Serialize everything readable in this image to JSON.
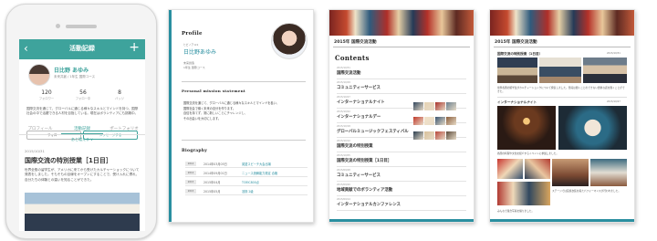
{
  "phone": {
    "app_title": "活動記録",
    "back_glyph": "‹",
    "plus_glyph": "+",
    "name": "日比野 あゆみ",
    "subtitle": "未来共創 / 1年生 国際コース",
    "stats": [
      {
        "value": "120",
        "label": "フォロワー"
      },
      {
        "value": "56",
        "label": "フォロー中"
      },
      {
        "value": "8",
        "label": "バッジ"
      }
    ],
    "description": "国際交流を通じて、グローバルに通じる様々なスキルとマインドを持つ、国際社会の中で活躍できる人材を目指している。現在はボランティアにも挑戦中。",
    "btn_follow": "フォロー",
    "btn_message": "メッセージする",
    "tabs": [
      "プロフィール",
      "活動記録",
      "ポートフォリオ"
    ],
    "more": "あと増える ∨",
    "article_date": "2015/10/31",
    "article_title": "国際交流の特別授業［1日目］",
    "article_body": "世界全般の留学生が、アメリカに来てから受けたカルチャーショックについて発表をしました。そもそもの目線をオープンにすることで、受け入れに慣れ、自分たちの体験との違いを知ることができた。"
  },
  "page1": {
    "section_profile": "Profile",
    "name_small": "ヒビノアユミ",
    "name": "日比野あゆみ",
    "meta1": "未来創造",
    "meta2": "1年生 国際コース",
    "section_mission": "Personal mission statement",
    "mission_lines": [
      "国際交流を通じて、グローバルに通じる様々なスキルとマインドを養い、",
      "国際社会で働く未来の自分を作ります。",
      "自信を持てず、常に新しいことにチャレンジし、",
      "その出会いを大切にします。"
    ],
    "section_bio": "Biography",
    "bio": [
      {
        "year": "2014",
        "date": "2014年03月05日",
        "title": "英語スピーチ大会出場"
      },
      {
        "year": "2014",
        "date": "2014年09月01日",
        "title": "ニュース読解能力検定 合格"
      },
      {
        "year": "2015",
        "date": "2015年04月",
        "title": "TOEIC800点"
      },
      {
        "year": "2015",
        "date": "2015年05月",
        "title": "漢検 2級"
      }
    ]
  },
  "page2": {
    "banner_title": "2015年 国際交流活動",
    "contents_heading": "Contents",
    "toc": [
      {
        "date": "2015/10/31",
        "title": "国際交流活動"
      },
      {
        "date": "2015/10/29",
        "title": "コミュニティーサービス"
      },
      {
        "date": "2015/10/27",
        "title": "インターナショナルナイト"
      },
      {
        "date": "2015/10/22",
        "title": "インターナショナルデー"
      },
      {
        "date": "2015/10/18",
        "title": "グローバルミュージックフェスティバル"
      },
      {
        "date": "2015/10/12",
        "title": "国際交流の特別授業"
      },
      {
        "date": "2015/10/05",
        "title": "国際交流の特別授業［1日目］"
      },
      {
        "date": "2015/09/28",
        "title": "コミュニティーサービス"
      },
      {
        "date": "2015/09/20",
        "title": "地域貢献でのボランティア活動"
      },
      {
        "date": "2015/09/14",
        "title": "インターナショナルカンファレンス"
      }
    ]
  },
  "page3": {
    "banner_title": "2015年 国際交流活動",
    "date1": "2015/10/31",
    "heading1": "国際交流の特別授業（1日目）",
    "body1": "世界各国の留学生がカルチャーショックについて発表しました。普段は聞くことのできない貴重な話を聞くことができた。",
    "heading2": "インターナショナルナイト",
    "date2": "2015/10/27",
    "body2": "各国の料理や文化を紹介するイベントに参加しました。",
    "body3": "ステージでは民族衣装を着たパフォーマンスが行われました。",
    "body4": "みんなで集合写真を撮りました。"
  }
}
